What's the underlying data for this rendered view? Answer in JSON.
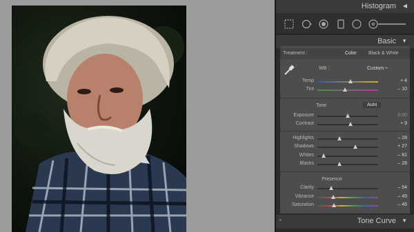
{
  "panels": {
    "histogram": {
      "title": "Histogram"
    },
    "basic": {
      "title": "Basic"
    },
    "tone_curve": {
      "title": "Tone Curve"
    }
  },
  "treatment": {
    "label": "Treatment :",
    "color": "Color",
    "bw": "Black & White"
  },
  "wb": {
    "label": "WB :",
    "value": "Custom ÷"
  },
  "tone": {
    "title": "Tone",
    "auto": "Auto"
  },
  "presence": {
    "title": "Presence"
  },
  "sliders": [
    {
      "id": "temp",
      "label": "Temp",
      "value": "+ 4",
      "pos": 0.54
    },
    {
      "id": "tint",
      "label": "Tint",
      "value": "– 10",
      "pos": 0.46
    },
    {
      "id": "exposure",
      "label": "Exposure",
      "value": "0,00",
      "pos": 0.5
    },
    {
      "id": "contrast",
      "label": "Contrast",
      "value": "+ 9",
      "pos": 0.54
    },
    {
      "id": "highlights",
      "label": "Highlights",
      "value": "– 28",
      "pos": 0.36
    },
    {
      "id": "shadows",
      "label": "Shadows",
      "value": "+ 27",
      "pos": 0.63
    },
    {
      "id": "whites",
      "label": "Whites",
      "value": "– 81",
      "pos": 0.1
    },
    {
      "id": "blacks",
      "label": "Blacks",
      "value": "– 28",
      "pos": 0.36
    },
    {
      "id": "clarity",
      "label": "Clarity",
      "value": "– 54",
      "pos": 0.23
    },
    {
      "id": "vibrance",
      "label": "Vibrance",
      "value": "– 49",
      "pos": 0.26
    },
    {
      "id": "saturation",
      "label": "Saturation",
      "value": "– 46",
      "pos": 0.27
    }
  ],
  "colors": {
    "panel": "#2b2b2b",
    "section": "#4d4d4d",
    "header": "#3a3a3a"
  },
  "icons": [
    "crop-overlay-icon",
    "spot-removal-icon",
    "red-eye-icon",
    "graduated-filter-icon",
    "radial-filter-icon",
    "adjustment-brush-icon",
    "eyedropper-icon"
  ]
}
